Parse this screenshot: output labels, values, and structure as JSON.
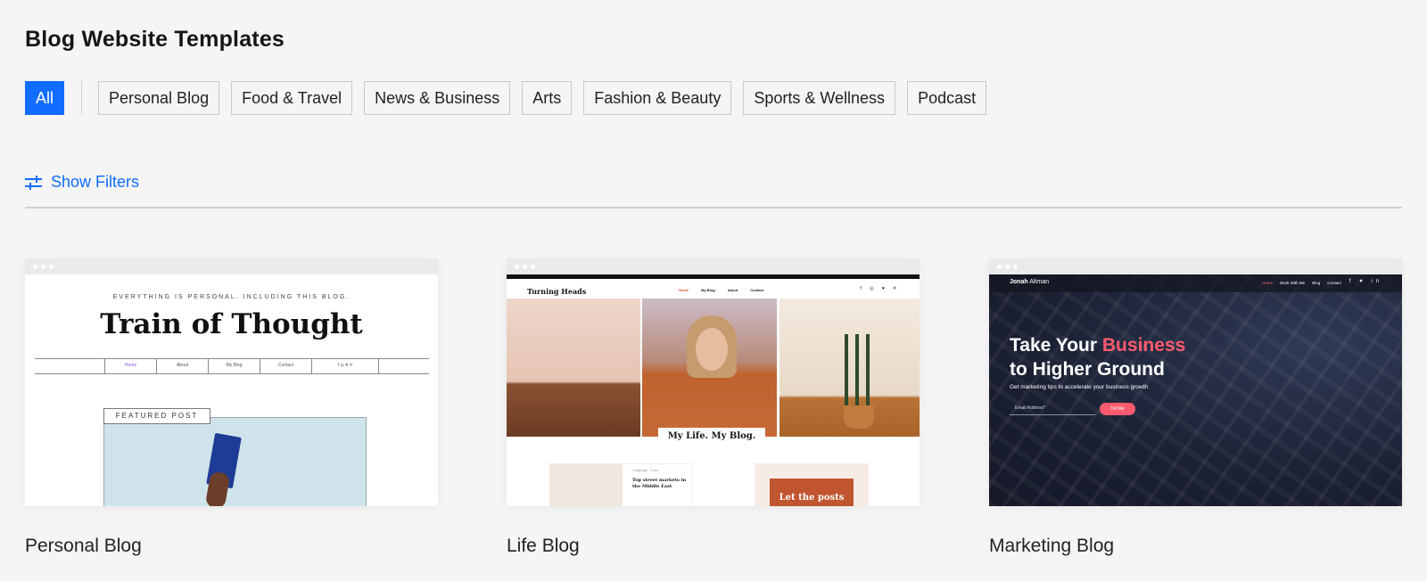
{
  "page": {
    "title": "Blog Website Templates"
  },
  "categories": [
    "All",
    "Personal Blog",
    "Food & Travel",
    "News & Business",
    "Arts",
    "Fashion & Beauty",
    "Sports & Wellness",
    "Podcast"
  ],
  "active_category": "All",
  "filters": {
    "label": "Show Filters",
    "icon": "sliders-icon"
  },
  "colors": {
    "accent": "#116dff",
    "background": "#f4f5f4",
    "marketing_accent": "#ff5b6f"
  },
  "templates": [
    {
      "name": "Personal Blog",
      "preview": {
        "tagline": "EVERYTHING IS PERSONAL. INCLUDING THIS BLOG.",
        "headline": "Train of Thought",
        "nav": [
          "Home",
          "About",
          "My Blog",
          "Contact"
        ],
        "social": "f ◎ ♥ ℗",
        "featured": "FEATURED POST"
      }
    },
    {
      "name": "Life Blog",
      "preview": {
        "logo": "Turning Heads",
        "nav": [
          "Home",
          "My Blog",
          "About",
          "Contact"
        ],
        "social": "f ◎ ♥ ℗",
        "motto": "My Life. My Blog.",
        "post_meta": "4 days ago · 2 min",
        "post_title": "Top street markets in the Middle East",
        "cta": "Let the posts"
      }
    },
    {
      "name": "Marketing Blog",
      "preview": {
        "logo_first": "Jonah",
        "logo_last": "Altman",
        "nav": [
          "Home",
          "Work With Me",
          "Blog",
          "Contact"
        ],
        "social": "f ♥ in",
        "headline_1": "Take Your",
        "headline_accent": "Business",
        "headline_2": "to Higher Ground",
        "subtitle": "Get marketing tips to accelerate your business growth",
        "email_placeholder": "Email Address*",
        "button": "Tell Me"
      }
    }
  ]
}
